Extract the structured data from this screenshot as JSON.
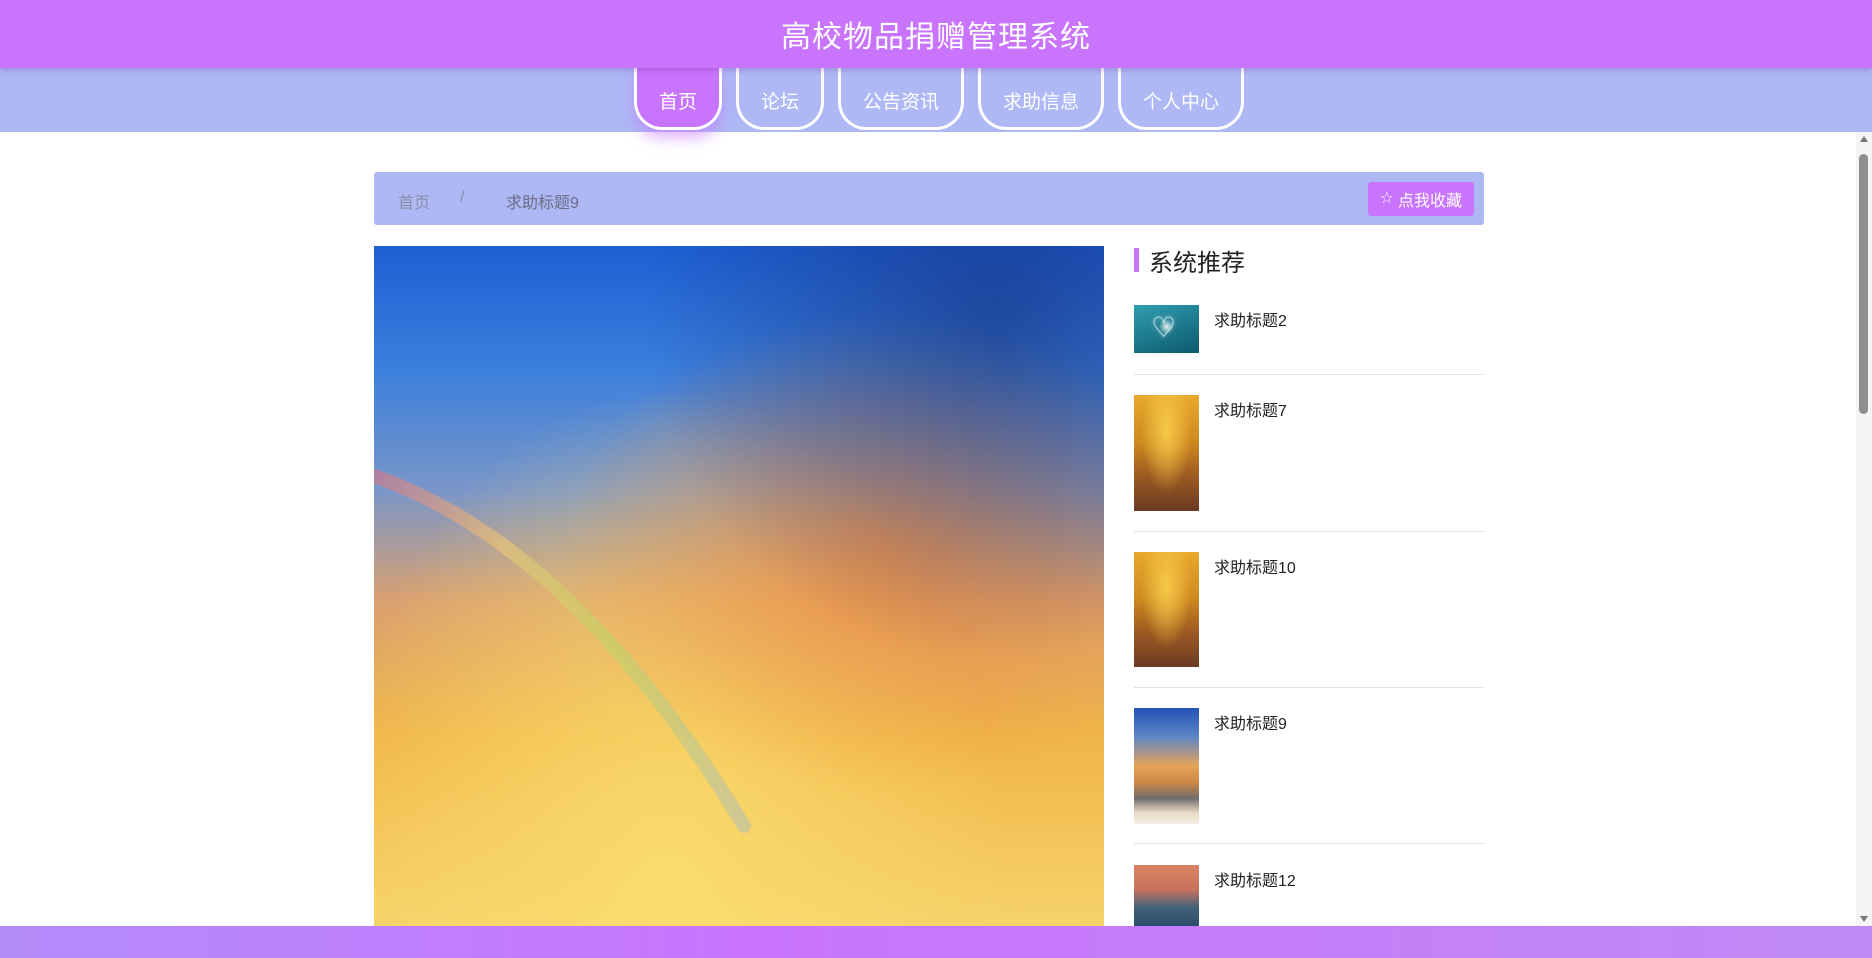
{
  "header": {
    "site_title": "高校物品捐赠管理系统"
  },
  "nav": {
    "items": [
      {
        "label": "首页",
        "active": true
      },
      {
        "label": "论坛",
        "active": false
      },
      {
        "label": "公告资讯",
        "active": false
      },
      {
        "label": "求助信息",
        "active": false
      },
      {
        "label": "个人中心",
        "active": false
      }
    ]
  },
  "breadcrumb": {
    "home": "首页",
    "separator": "/",
    "current": "求助标题9"
  },
  "actions": {
    "collect_label": "点我收藏",
    "collect_icon": "star-outline-icon"
  },
  "sidebar": {
    "title": "系统推荐",
    "items": [
      {
        "title": "求助标题2",
        "thumbnail": "heart-island"
      },
      {
        "title": "求助标题7",
        "thumbnail": "autumn-path"
      },
      {
        "title": "求助标题10",
        "thumbnail": "autumn-path"
      },
      {
        "title": "求助标题9",
        "thumbnail": "rainbow-beach"
      },
      {
        "title": "求助标题12",
        "thumbnail": "sunset-lake"
      }
    ]
  },
  "colors": {
    "primary": "#c874fd",
    "nav_background": "#adb8f5"
  }
}
